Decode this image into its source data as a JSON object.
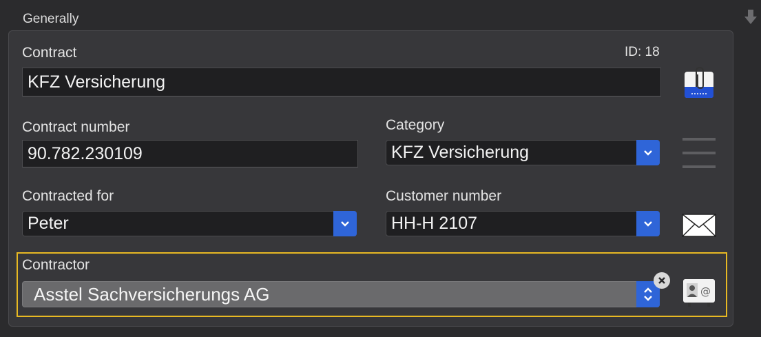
{
  "section": {
    "title": "Generally"
  },
  "contract": {
    "label": "Contract",
    "id_text": "ID: 18",
    "value": "KFZ Versicherung"
  },
  "contract_number": {
    "label": "Contract number",
    "value": "90.782.230109"
  },
  "category": {
    "label": "Category",
    "selected": "KFZ Versicherung"
  },
  "contracted_for": {
    "label": "Contracted for",
    "selected": "Peter"
  },
  "customer_number": {
    "label": "Customer number",
    "selected": "HH-H 2107"
  },
  "contractor": {
    "label": "Contractor",
    "value": "Asstel Sachversicherungs AG"
  },
  "colors": {
    "accent": "#2f65d8",
    "highlight_frame": "#e8b923"
  },
  "icons": {
    "collapse": "down-arrow-icon",
    "attachment": "paperclip-document-icon",
    "details": "list-lines-icon",
    "mail": "envelope-icon",
    "contacts": "address-card-icon"
  }
}
